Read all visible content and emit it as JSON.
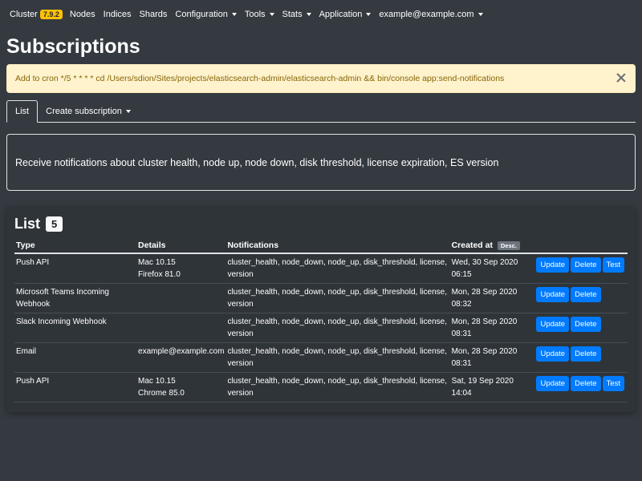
{
  "navbar": {
    "brand": "Cluster",
    "version": "7.9.2",
    "items": [
      {
        "label": "Nodes",
        "dropdown": false
      },
      {
        "label": "Indices",
        "dropdown": false
      },
      {
        "label": "Shards",
        "dropdown": false
      },
      {
        "label": "Configuration",
        "dropdown": true
      },
      {
        "label": "Tools",
        "dropdown": true
      },
      {
        "label": "Stats",
        "dropdown": true
      },
      {
        "label": "Application",
        "dropdown": true
      },
      {
        "label": "example@example.com",
        "dropdown": true
      }
    ]
  },
  "page": {
    "title": "Subscriptions"
  },
  "alert": {
    "text": "Add to cron */5 * * * * cd /Users/sdion/Sites/projects/elasticsearch-admin/elasticsearch-admin && bin/console app:send-notifications"
  },
  "tabs": {
    "list": "List",
    "create": "Create subscription"
  },
  "info": {
    "text": "Receive notifications about cluster health, node up, node down, disk threshold, license expiration, ES version"
  },
  "list": {
    "title": "List",
    "count": "5",
    "columns": {
      "type": "Type",
      "details": "Details",
      "notifications": "Notifications",
      "created": "Created at",
      "sort": "Desc."
    },
    "rows": [
      {
        "type": "Push API",
        "details": [
          "Mac 10.15",
          "Firefox 81.0"
        ],
        "notifications": "cluster_health, node_down, node_up, disk_threshold, license, version",
        "created": "Wed, 30 Sep 2020 06:15",
        "buttons": [
          "Update",
          "Delete",
          "Test"
        ]
      },
      {
        "type": "Microsoft Teams Incoming Webhook",
        "details": [],
        "notifications": "cluster_health, node_down, node_up, disk_threshold, license, version",
        "created": "Mon, 28 Sep 2020 08:32",
        "buttons": [
          "Update",
          "Delete"
        ]
      },
      {
        "type": "Slack Incoming Webhook",
        "details": [],
        "notifications": "cluster_health, node_down, node_up, disk_threshold, license, version",
        "created": "Mon, 28 Sep 2020 08:31",
        "buttons": [
          "Update",
          "Delete"
        ]
      },
      {
        "type": "Email",
        "details": [
          "example@example.com"
        ],
        "notifications": "cluster_health, node_down, node_up, disk_threshold, license, version",
        "created": "Mon, 28 Sep 2020 08:31",
        "buttons": [
          "Update",
          "Delete"
        ]
      },
      {
        "type": "Push API",
        "details": [
          "Mac 10.15",
          "Chrome 85.0"
        ],
        "notifications": "cluster_health, node_down, node_up, disk_threshold, license, version",
        "created": "Sat, 19 Sep 2020 14:04",
        "buttons": [
          "Update",
          "Delete",
          "Test"
        ]
      }
    ]
  },
  "colors": {
    "background": "#343a40",
    "primary": "#007bff",
    "warning_badge": "#ffc107",
    "alert_bg": "#fff3cd",
    "alert_text": "#856404"
  }
}
